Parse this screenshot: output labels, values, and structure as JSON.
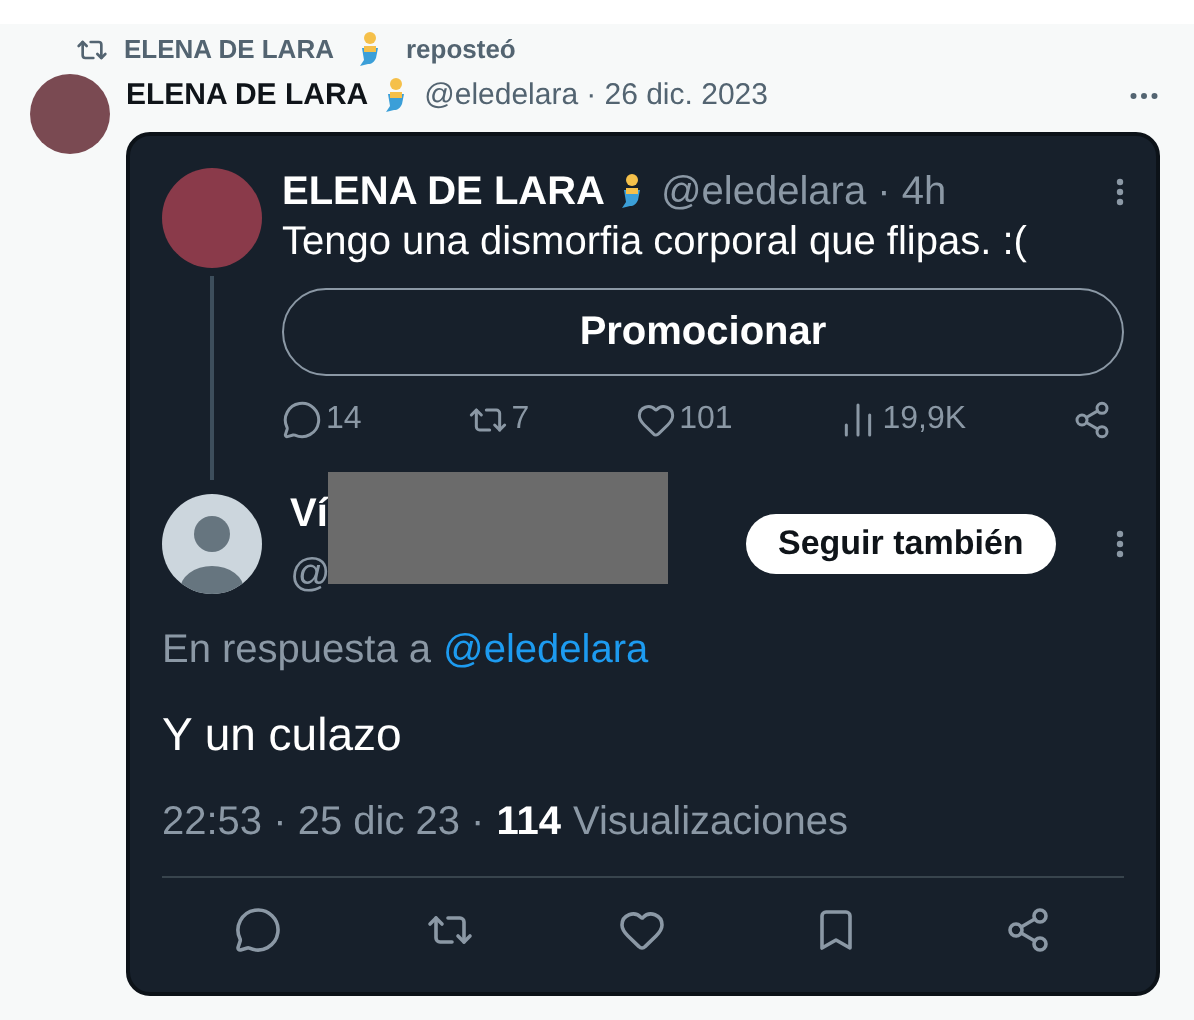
{
  "repost": {
    "name": "ELENA DE LARA",
    "action": "reposteó"
  },
  "post": {
    "name": "ELENA DE LARA",
    "handle": "@eledelara",
    "date": "· 26 dic. 2023"
  },
  "screenshot": {
    "original": {
      "name": "ELENA DE LARA",
      "handle": "@eledelara · 4h",
      "text": "Tengo una dismorfia corporal que flipas. :(",
      "button": "Promocionar",
      "stats": [
        {
          "kind": "reply",
          "count": "14"
        },
        {
          "kind": "repost",
          "count": "7"
        },
        {
          "kind": "like",
          "count": "101"
        },
        {
          "kind": "views",
          "count": "19,9K"
        },
        {
          "kind": "share"
        }
      ]
    },
    "reply": {
      "name": "Ví",
      "handle": "@",
      "follow": "Seguir también",
      "in_reply_prefix": "En respuesta a",
      "in_reply_handle": "@eledelara",
      "text": "Y un culazo",
      "time": "22:53 · 25 dic 23 ·",
      "views_count": "114",
      "views_label": "Visualizaciones",
      "actions": [
        {
          "kind": "reply"
        },
        {
          "kind": "repost"
        },
        {
          "kind": "like"
        },
        {
          "kind": "bookmark"
        },
        {
          "kind": "share"
        }
      ]
    }
  }
}
